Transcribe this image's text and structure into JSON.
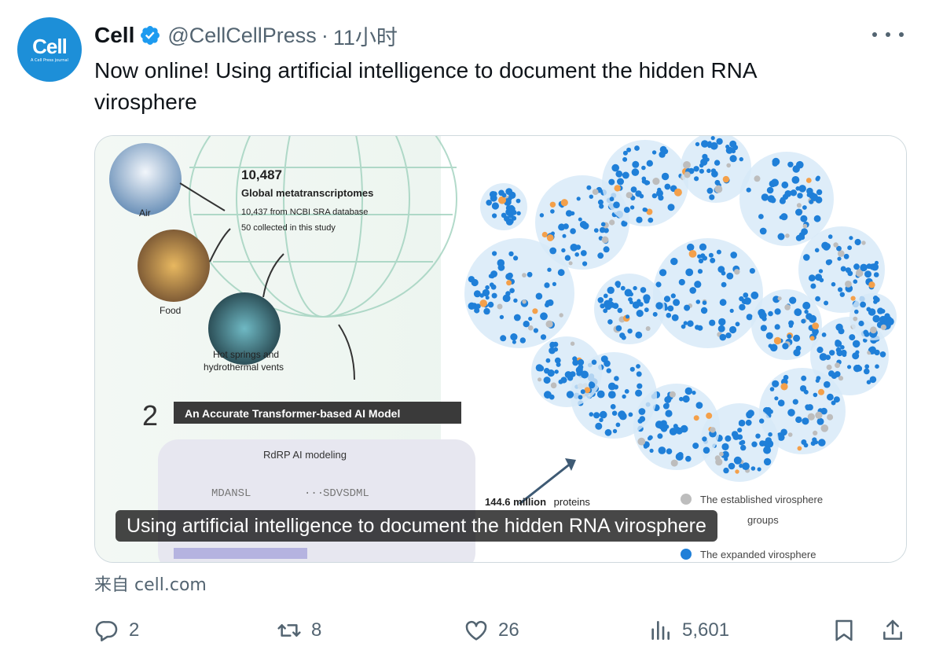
{
  "author": {
    "avatar_logo": "Cell",
    "avatar_sub": "A Cell Press journal",
    "name": "Cell",
    "handle": "@CellCellPress",
    "separator": "·",
    "time": "11小时"
  },
  "tweet_text": "Now online!  Using artificial intelligence to document the hidden RNA virosphere",
  "card": {
    "title": "Using artificial intelligence to document the hidden RNA virosphere",
    "image_text": {
      "count": "10,487",
      "meta_title": "Global metatranscriptomes",
      "meta_line1": "10,437 from NCBI SRA database",
      "meta_line2": "50 collected in this study",
      "air": "Air",
      "food": "Food",
      "hot_springs_1": "Hot springs and",
      "hot_springs_2": "hydrothermal vents",
      "step_number": "2",
      "step_label": "An Accurate Transformer-based AI Model",
      "rdrp": "RdRP AI modeling",
      "seq_left": "MDANSL",
      "seq_mid": "···",
      "seq_right": "SDVSDML",
      "proteins_num": "144.6 million",
      "proteins_word": "proteins",
      "legend_established": "The established virosphere",
      "legend_groups": "groups",
      "legend_expanded": "The expanded virosphere"
    }
  },
  "source": "来自 cell.com",
  "actions": {
    "replies": "2",
    "retweets": "8",
    "likes": "26",
    "views": "5,601"
  },
  "colors": {
    "brand_blue": "#1d8fd8",
    "verified_blue": "#1d9bf0",
    "muted": "#536471",
    "text": "#0f1419"
  }
}
